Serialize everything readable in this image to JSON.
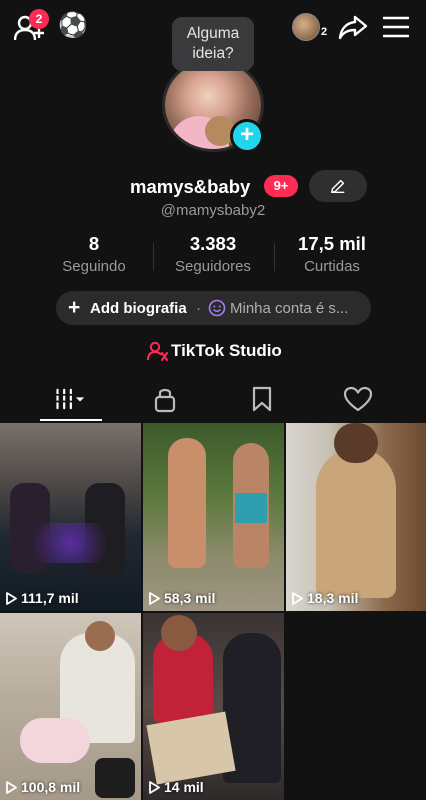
{
  "header": {
    "friend_requests_count": "2",
    "emoji_badge": "⚽",
    "accounts_count": "2"
  },
  "tooltip": {
    "text_line1": "Alguma",
    "text_line2": "ideia?"
  },
  "profile": {
    "username": "mamys&baby",
    "notifications": "9+",
    "handle": "@mamysbaby2"
  },
  "stats": [
    {
      "value": "8",
      "label": "Seguindo"
    },
    {
      "value": "3.383",
      "label": "Seguidores"
    },
    {
      "value": "17,5 mil",
      "label": "Curtidas"
    }
  ],
  "bio": {
    "add_label": "Add biografia",
    "separator": "·",
    "privacy_label": "Minha conta é s..."
  },
  "studio": {
    "label": "TikTok Studio"
  },
  "tabs": [
    {
      "icon": "videos-grid-icon",
      "active": true
    },
    {
      "icon": "lock-icon",
      "active": false
    },
    {
      "icon": "bookmark-icon",
      "active": false
    },
    {
      "icon": "heart-icon",
      "active": false
    }
  ],
  "videos": [
    {
      "views": "111,7 mil"
    },
    {
      "views": "58,3 mil"
    },
    {
      "views": "18,3 mil"
    },
    {
      "views": "100,8 mil"
    },
    {
      "views": "14 mil"
    }
  ],
  "colors": {
    "background": "#121212",
    "accent_pink": "#fe2c55",
    "accent_cyan": "#20d5ec",
    "muted_text": "#9a9a9a"
  }
}
